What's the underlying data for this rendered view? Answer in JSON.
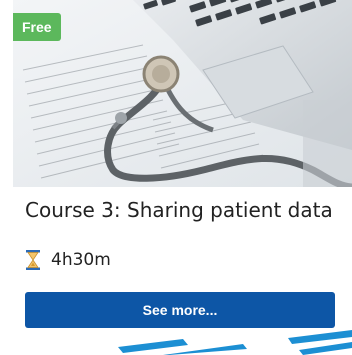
{
  "card": {
    "badge": "Free",
    "title": "Course 3: Sharing patient data",
    "duration": "4h30m",
    "button_label": "See more...",
    "image_subject": "stethoscope on laptop and paperwork",
    "icons": {
      "duration": "hourglass-icon"
    },
    "colors": {
      "badge": "#5cb85c",
      "button": "#0d56a6",
      "stripes": "#1c8fd3"
    }
  }
}
